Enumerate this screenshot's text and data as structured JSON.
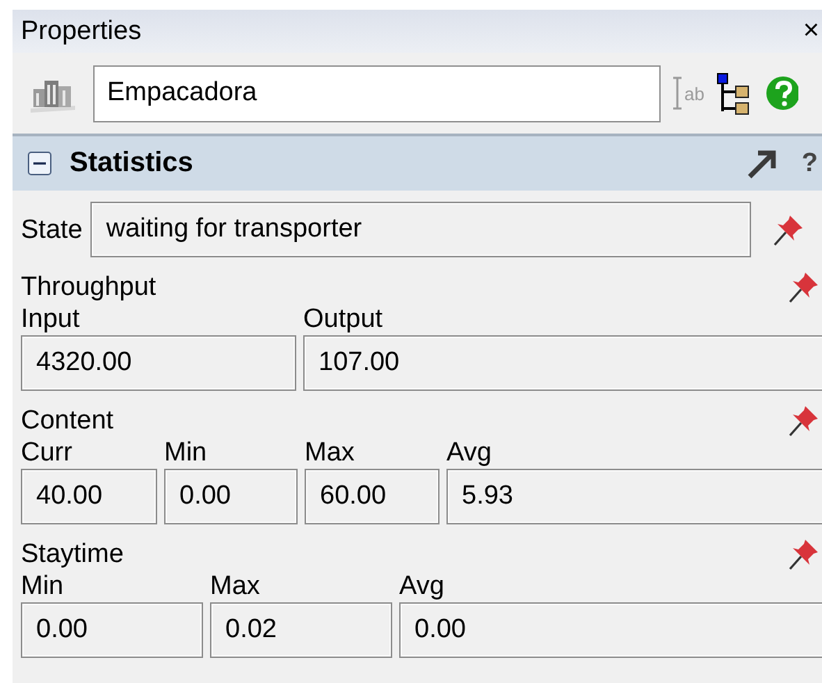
{
  "panel": {
    "title": "Properties",
    "close": "×"
  },
  "toolbar": {
    "name_value": "Empacadora",
    "text_mode_label": "ab"
  },
  "section": {
    "title": "Statistics",
    "expanded": true,
    "help": "?"
  },
  "groups": [
    {
      "kind": "inline",
      "label": "State",
      "value": "waiting for transporter"
    },
    {
      "kind": "grid",
      "label": "Throughput",
      "fields": [
        {
          "label": "Input",
          "value": "4320.00"
        },
        {
          "label": "Output",
          "value": "107.00"
        }
      ]
    },
    {
      "kind": "grid",
      "label": "Content",
      "fields": [
        {
          "label": "Curr",
          "value": "40.00"
        },
        {
          "label": "Min",
          "value": "0.00"
        },
        {
          "label": "Max",
          "value": "60.00"
        },
        {
          "label": "Avg",
          "value": "5.93"
        }
      ]
    },
    {
      "kind": "grid",
      "label": "Staytime",
      "fields": [
        {
          "label": "Min",
          "value": "0.00"
        },
        {
          "label": "Max",
          "value": "0.02"
        },
        {
          "label": "Avg",
          "value": "0.00"
        }
      ]
    }
  ]
}
